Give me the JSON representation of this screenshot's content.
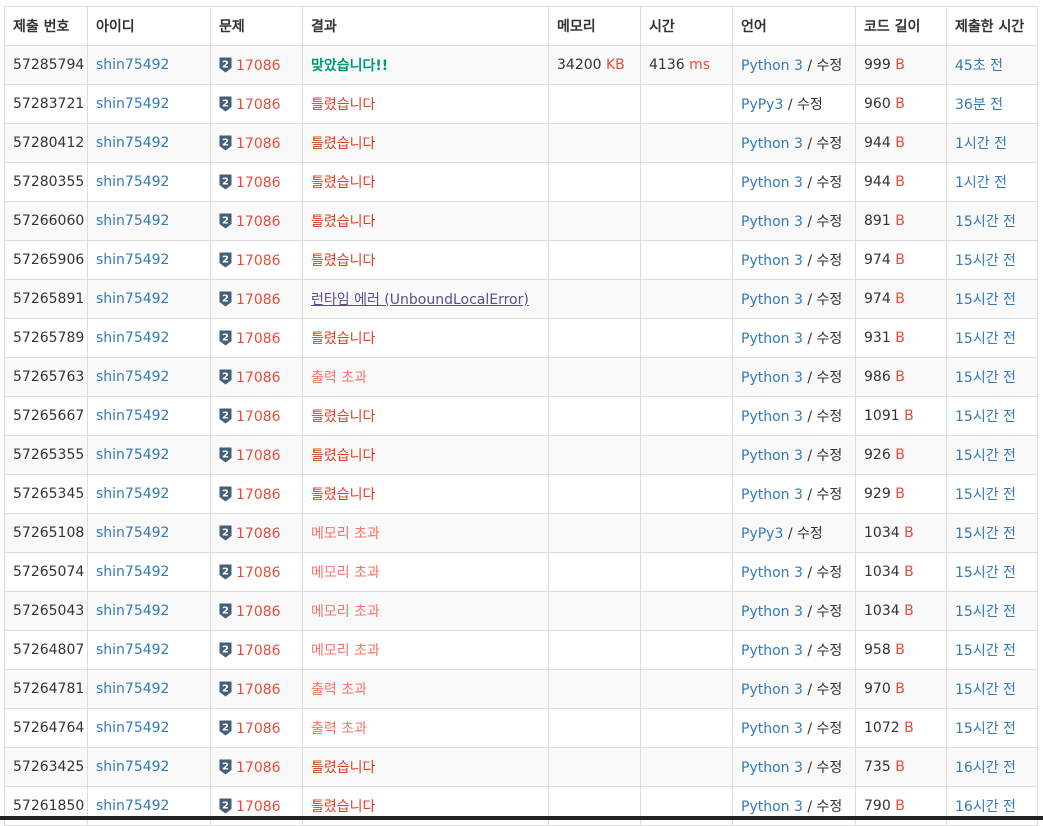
{
  "headers": [
    "제출 번호",
    "아이디",
    "문제",
    "결과",
    "메모리",
    "시간",
    "언어",
    "코드 길이",
    "제출한 시간"
  ],
  "rows": [
    {
      "id": "57285794",
      "user": "shin75492",
      "problem": "17086",
      "tier": "2",
      "result": "맞았습니다!!",
      "result_class": "res-ac",
      "memory": "34200",
      "memory_unit": "KB",
      "time": "4136",
      "time_unit": "ms",
      "lang": "Python 3",
      "edit": "수정",
      "length": "999",
      "length_unit": "B",
      "submitted": "45초 전"
    },
    {
      "id": "57283721",
      "user": "shin75492",
      "problem": "17086",
      "tier": "2",
      "result": "틀렸습니다",
      "result_class": "res-wa",
      "memory": "",
      "memory_unit": "",
      "time": "",
      "time_unit": "",
      "lang": "PyPy3",
      "edit": "수정",
      "length": "960",
      "length_unit": "B",
      "submitted": "36분 전"
    },
    {
      "id": "57280412",
      "user": "shin75492",
      "problem": "17086",
      "tier": "2",
      "result": "틀렸습니다",
      "result_class": "res-wa",
      "memory": "",
      "memory_unit": "",
      "time": "",
      "time_unit": "",
      "lang": "Python 3",
      "edit": "수정",
      "length": "944",
      "length_unit": "B",
      "submitted": "1시간 전"
    },
    {
      "id": "57280355",
      "user": "shin75492",
      "problem": "17086",
      "tier": "2",
      "result": "틀렸습니다",
      "result_class": "res-wa",
      "memory": "",
      "memory_unit": "",
      "time": "",
      "time_unit": "",
      "lang": "Python 3",
      "edit": "수정",
      "length": "944",
      "length_unit": "B",
      "submitted": "1시간 전"
    },
    {
      "id": "57266060",
      "user": "shin75492",
      "problem": "17086",
      "tier": "2",
      "result": "틀렸습니다",
      "result_class": "res-wa",
      "memory": "",
      "memory_unit": "",
      "time": "",
      "time_unit": "",
      "lang": "Python 3",
      "edit": "수정",
      "length": "891",
      "length_unit": "B",
      "submitted": "15시간 전"
    },
    {
      "id": "57265906",
      "user": "shin75492",
      "problem": "17086",
      "tier": "2",
      "result": "틀렸습니다",
      "result_class": "res-wa",
      "memory": "",
      "memory_unit": "",
      "time": "",
      "time_unit": "",
      "lang": "Python 3",
      "edit": "수정",
      "length": "974",
      "length_unit": "B",
      "submitted": "15시간 전"
    },
    {
      "id": "57265891",
      "user": "shin75492",
      "problem": "17086",
      "tier": "2",
      "result": "런타임 에러 (UnboundLocalError)",
      "result_class": "res-rte",
      "memory": "",
      "memory_unit": "",
      "time": "",
      "time_unit": "",
      "lang": "Python 3",
      "edit": "수정",
      "length": "974",
      "length_unit": "B",
      "submitted": "15시간 전"
    },
    {
      "id": "57265789",
      "user": "shin75492",
      "problem": "17086",
      "tier": "2",
      "result": "틀렸습니다",
      "result_class": "res-wa",
      "memory": "",
      "memory_unit": "",
      "time": "",
      "time_unit": "",
      "lang": "Python 3",
      "edit": "수정",
      "length": "931",
      "length_unit": "B",
      "submitted": "15시간 전"
    },
    {
      "id": "57265763",
      "user": "shin75492",
      "problem": "17086",
      "tier": "2",
      "result": "출력 초과",
      "result_class": "res-oe",
      "memory": "",
      "memory_unit": "",
      "time": "",
      "time_unit": "",
      "lang": "Python 3",
      "edit": "수정",
      "length": "986",
      "length_unit": "B",
      "submitted": "15시간 전"
    },
    {
      "id": "57265667",
      "user": "shin75492",
      "problem": "17086",
      "tier": "2",
      "result": "틀렸습니다",
      "result_class": "res-wa",
      "memory": "",
      "memory_unit": "",
      "time": "",
      "time_unit": "",
      "lang": "Python 3",
      "edit": "수정",
      "length": "1091",
      "length_unit": "B",
      "submitted": "15시간 전"
    },
    {
      "id": "57265355",
      "user": "shin75492",
      "problem": "17086",
      "tier": "2",
      "result": "틀렸습니다",
      "result_class": "res-wa",
      "memory": "",
      "memory_unit": "",
      "time": "",
      "time_unit": "",
      "lang": "Python 3",
      "edit": "수정",
      "length": "926",
      "length_unit": "B",
      "submitted": "15시간 전"
    },
    {
      "id": "57265345",
      "user": "shin75492",
      "problem": "17086",
      "tier": "2",
      "result": "틀렸습니다",
      "result_class": "res-wa",
      "memory": "",
      "memory_unit": "",
      "time": "",
      "time_unit": "",
      "lang": "Python 3",
      "edit": "수정",
      "length": "929",
      "length_unit": "B",
      "submitted": "15시간 전"
    },
    {
      "id": "57265108",
      "user": "shin75492",
      "problem": "17086",
      "tier": "2",
      "result": "메모리 초과",
      "result_class": "res-mle",
      "memory": "",
      "memory_unit": "",
      "time": "",
      "time_unit": "",
      "lang": "PyPy3",
      "edit": "수정",
      "length": "1034",
      "length_unit": "B",
      "submitted": "15시간 전"
    },
    {
      "id": "57265074",
      "user": "shin75492",
      "problem": "17086",
      "tier": "2",
      "result": "메모리 초과",
      "result_class": "res-mle",
      "memory": "",
      "memory_unit": "",
      "time": "",
      "time_unit": "",
      "lang": "Python 3",
      "edit": "수정",
      "length": "1034",
      "length_unit": "B",
      "submitted": "15시간 전"
    },
    {
      "id": "57265043",
      "user": "shin75492",
      "problem": "17086",
      "tier": "2",
      "result": "메모리 초과",
      "result_class": "res-mle",
      "memory": "",
      "memory_unit": "",
      "time": "",
      "time_unit": "",
      "lang": "Python 3",
      "edit": "수정",
      "length": "1034",
      "length_unit": "B",
      "submitted": "15시간 전"
    },
    {
      "id": "57264807",
      "user": "shin75492",
      "problem": "17086",
      "tier": "2",
      "result": "메모리 초과",
      "result_class": "res-mle",
      "memory": "",
      "memory_unit": "",
      "time": "",
      "time_unit": "",
      "lang": "Python 3",
      "edit": "수정",
      "length": "958",
      "length_unit": "B",
      "submitted": "15시간 전"
    },
    {
      "id": "57264781",
      "user": "shin75492",
      "problem": "17086",
      "tier": "2",
      "result": "출력 초과",
      "result_class": "res-oe",
      "memory": "",
      "memory_unit": "",
      "time": "",
      "time_unit": "",
      "lang": "Python 3",
      "edit": "수정",
      "length": "970",
      "length_unit": "B",
      "submitted": "15시간 전"
    },
    {
      "id": "57264764",
      "user": "shin75492",
      "problem": "17086",
      "tier": "2",
      "result": "출력 초과",
      "result_class": "res-oe",
      "memory": "",
      "memory_unit": "",
      "time": "",
      "time_unit": "",
      "lang": "Python 3",
      "edit": "수정",
      "length": "1072",
      "length_unit": "B",
      "submitted": "15시간 전"
    },
    {
      "id": "57263425",
      "user": "shin75492",
      "problem": "17086",
      "tier": "2",
      "result": "틀렸습니다",
      "result_class": "res-wa",
      "memory": "",
      "memory_unit": "",
      "time": "",
      "time_unit": "",
      "lang": "Python 3",
      "edit": "수정",
      "length": "735",
      "length_unit": "B",
      "submitted": "16시간 전"
    },
    {
      "id": "57261850",
      "user": "shin75492",
      "problem": "17086",
      "tier": "2",
      "result": "틀렸습니다",
      "result_class": "res-wa",
      "memory": "",
      "memory_unit": "",
      "time": "",
      "time_unit": "",
      "lang": "Python 3",
      "edit": "수정",
      "length": "790",
      "length_unit": "B",
      "submitted": "16시간 전"
    }
  ],
  "colors": {
    "link": "#337ab7",
    "accepted": "#009874",
    "wrong": "#dd4124",
    "runtime_error": "#5f4b8b",
    "exceeded": "#fa7268",
    "unit": "#e74c3c",
    "tier_silver": "#435f7a"
  },
  "icons": {
    "tier": "silver-tier-icon"
  }
}
